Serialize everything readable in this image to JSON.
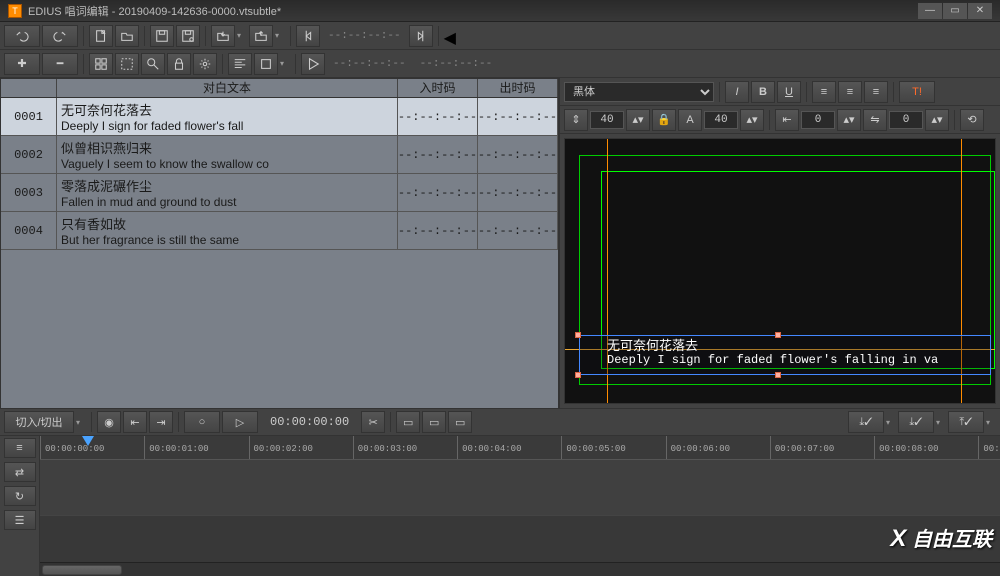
{
  "title": "EDIUS 唱词编辑 - 20190409-142636-0000.vtsubtle*",
  "toolbar": {
    "dash_in": "--:--:--:--",
    "dash_out": "--:--:--:--",
    "dash_dur": "--:--:--:--"
  },
  "preview": {
    "font_name": "黑体",
    "size_v": "40",
    "size_h": "40",
    "kerning_left": "0",
    "kerning_right": "0",
    "val_zero": "0",
    "sub_line1": "无可奈何花落去",
    "sub_line2": "Deeply I sign for faded flower's falling in va"
  },
  "table": {
    "head_text": "对白文本",
    "head_in": "入时码",
    "head_out": "出时码",
    "empty_tc": "--:--:--:--",
    "rows": [
      {
        "num": "0001",
        "cn": "无可奈何花落去",
        "en": "Deeply I sign for faded flower's fall"
      },
      {
        "num": "0002",
        "cn": "似曾相识燕归来",
        "en": "Vaguely I seem to know the swallow co"
      },
      {
        "num": "0003",
        "cn": "零落成泥碾作尘",
        "en": "Fallen in mud and ground to dust"
      },
      {
        "num": "0004",
        "cn": "只有香如故",
        "en": "But her fragrance is still the same"
      }
    ]
  },
  "transport": {
    "cut_label": "切入/切出",
    "timecode": "00:00:00:00"
  },
  "timeline": {
    "ticks": [
      "00:00:00:00",
      "00:00:01:00",
      "00:00:02:00",
      "00:00:03:00",
      "00:00:04:00",
      "00:00:05:00",
      "00:00:06:00",
      "00:00:07:00",
      "00:00:08:00"
    ],
    "end_tick": "00:"
  },
  "watermark": "自由互联"
}
